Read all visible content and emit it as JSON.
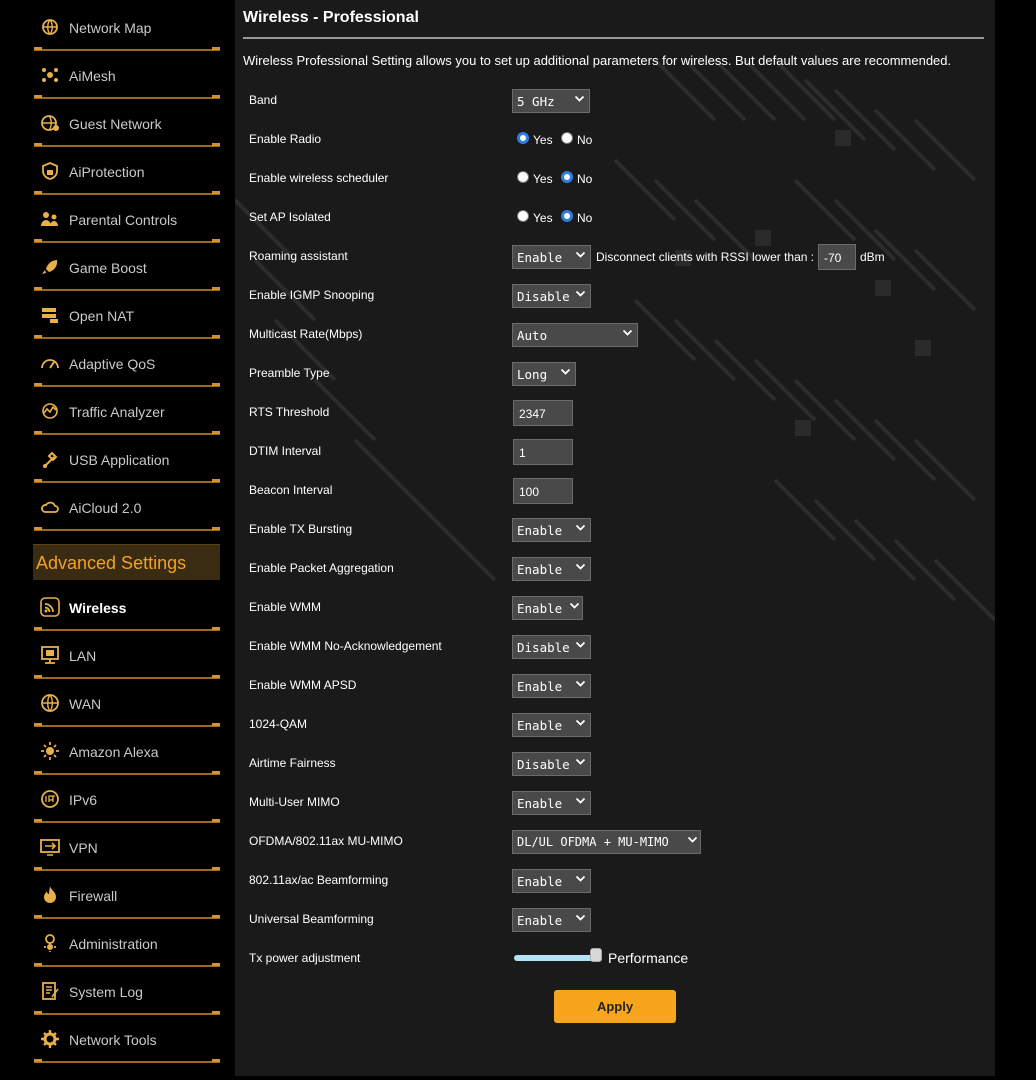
{
  "sidebar": {
    "items": [
      {
        "label": "Network Map",
        "icon": "network-map-icon"
      },
      {
        "label": "AiMesh",
        "icon": "aimesh-icon"
      },
      {
        "label": "Guest Network",
        "icon": "guest-network-icon"
      },
      {
        "label": "AiProtection",
        "icon": "aiprotection-icon"
      },
      {
        "label": "Parental Controls",
        "icon": "parental-controls-icon"
      },
      {
        "label": "Game Boost",
        "icon": "rocket-icon"
      },
      {
        "label": "Open NAT",
        "icon": "open-nat-icon"
      },
      {
        "label": "Adaptive QoS",
        "icon": "gauge-icon"
      },
      {
        "label": "Traffic Analyzer",
        "icon": "traffic-analyzer-icon"
      },
      {
        "label": "USB Application",
        "icon": "usb-icon"
      },
      {
        "label": "AiCloud 2.0",
        "icon": "cloud-icon"
      }
    ],
    "advanced_title": "Advanced Settings",
    "advanced_items": [
      {
        "label": "Wireless",
        "icon": "wireless-icon",
        "active": true
      },
      {
        "label": "LAN",
        "icon": "lan-icon"
      },
      {
        "label": "WAN",
        "icon": "wan-globe-icon"
      },
      {
        "label": "Amazon Alexa",
        "icon": "alexa-icon"
      },
      {
        "label": "IPv6",
        "icon": "ipv6-icon"
      },
      {
        "label": "VPN",
        "icon": "vpn-icon"
      },
      {
        "label": "Firewall",
        "icon": "firewall-icon"
      },
      {
        "label": "Administration",
        "icon": "administration-icon"
      },
      {
        "label": "System Log",
        "icon": "system-log-icon"
      },
      {
        "label": "Network Tools",
        "icon": "network-tools-icon"
      }
    ]
  },
  "page": {
    "title": "Wireless - Professional",
    "description": "Wireless Professional Setting allows you to set up additional parameters for wireless. But default values are recommended."
  },
  "settings": {
    "band": {
      "label": "Band",
      "value": "5 GHz"
    },
    "enable_radio": {
      "label": "Enable Radio",
      "yes": "Yes",
      "no": "No",
      "selected": "Yes"
    },
    "scheduler": {
      "label": "Enable wireless scheduler",
      "yes": "Yes",
      "no": "No",
      "selected": "No"
    },
    "ap_isolated": {
      "label": "Set AP Isolated",
      "yes": "Yes",
      "no": "No",
      "selected": "No"
    },
    "roaming": {
      "label": "Roaming assistant",
      "value": "Enable",
      "rssi_text": "Disconnect clients with RSSI lower than :",
      "rssi_value": "-70",
      "rssi_unit": "dBm"
    },
    "igmp": {
      "label": "Enable IGMP Snooping",
      "value": "Disable"
    },
    "multicast": {
      "label": "Multicast Rate(Mbps)",
      "value": "Auto"
    },
    "preamble": {
      "label": "Preamble Type",
      "value": "Long"
    },
    "rts": {
      "label": "RTS Threshold",
      "value": "2347"
    },
    "dtim": {
      "label": "DTIM Interval",
      "value": "1"
    },
    "beacon": {
      "label": "Beacon Interval",
      "value": "100"
    },
    "tx_bursting": {
      "label": "Enable TX Bursting",
      "value": "Enable"
    },
    "packet_agg": {
      "label": "Enable Packet Aggregation",
      "value": "Enable"
    },
    "wmm": {
      "label": "Enable WMM",
      "value": "Enable"
    },
    "wmm_noack": {
      "label": "Enable WMM No-Acknowledgement",
      "value": "Disable"
    },
    "wmm_apsd": {
      "label": "Enable WMM APSD",
      "value": "Enable"
    },
    "qam1024": {
      "label": "1024-QAM",
      "value": "Enable"
    },
    "airtime": {
      "label": "Airtime Fairness",
      "value": "Disable"
    },
    "mu_mimo": {
      "label": "Multi-User MIMO",
      "value": "Enable"
    },
    "ofdma": {
      "label": "OFDMA/802.11ax MU-MIMO",
      "value": "DL/UL OFDMA + MU-MIMO"
    },
    "beamforming": {
      "label": "802.11ax/ac Beamforming",
      "value": "Enable"
    },
    "universal_bf": {
      "label": "Universal Beamforming",
      "value": "Enable"
    },
    "tx_power": {
      "label": "Tx power adjustment",
      "level_text": "Performance",
      "level_fraction": 1.0
    }
  },
  "apply_label": "Apply",
  "colors": {
    "accent": "#f7a51c",
    "sidebar_rule": "#9c6a1c",
    "radio_on": "#2f7de1",
    "slider": "#b4e3f7"
  }
}
